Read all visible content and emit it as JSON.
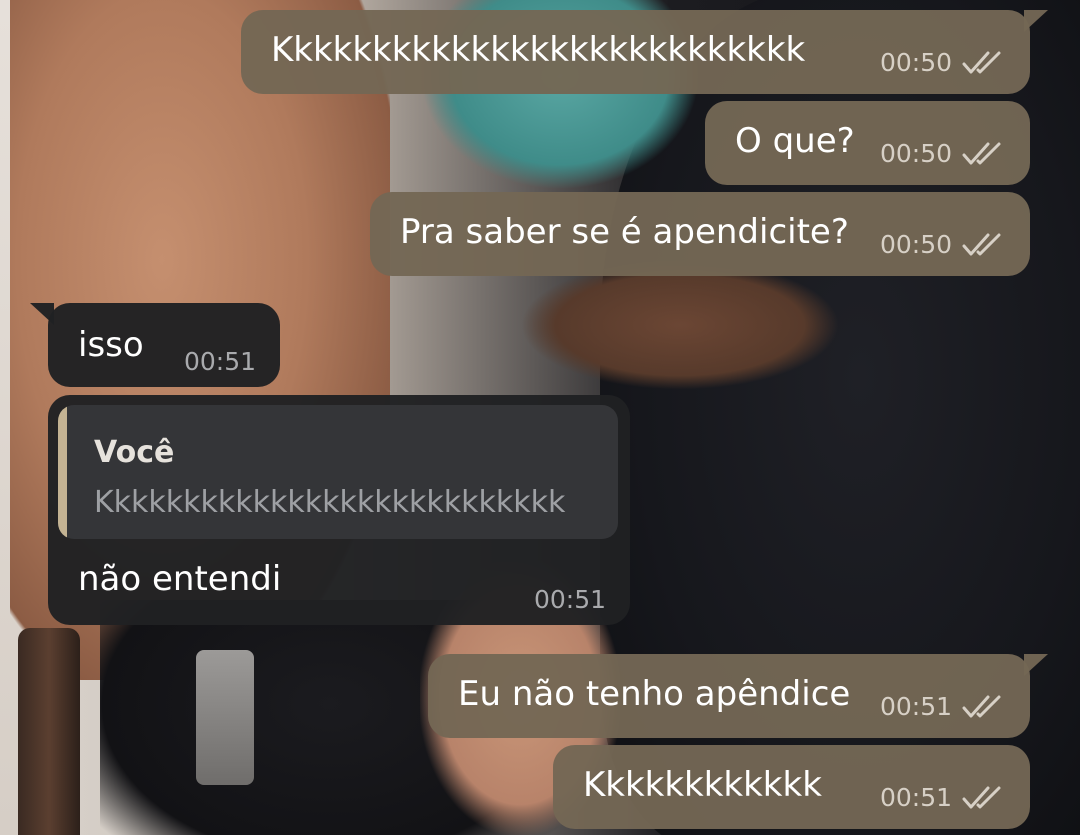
{
  "colors": {
    "outgoing_bubble": "#746754",
    "incoming_bubble": "#202123",
    "quote_accent": "#c4b393",
    "read_ticks": "#d7d0c6"
  },
  "wallpaper": {
    "type": "photo",
    "description_icon": "photo-wallpaper"
  },
  "messages": [
    {
      "direction": "out",
      "text": "Kkkkkkkkkkkkkkkkkkkkkkkkkkk",
      "time": "00:50",
      "status_icon": "double-check-icon"
    },
    {
      "direction": "out",
      "text": "O que?",
      "time": "00:50",
      "status_icon": "double-check-icon"
    },
    {
      "direction": "out",
      "text": "Pra saber se é apendicite?",
      "time": "00:50",
      "status_icon": "double-check-icon"
    },
    {
      "direction": "in",
      "text": "isso",
      "time": "00:51"
    },
    {
      "direction": "in",
      "text": "não entendi",
      "time": "00:51",
      "reply": {
        "author": "Você",
        "text": "Kkkkkkkkkkkkkkkkkkkkkkkkkkk"
      }
    },
    {
      "direction": "out",
      "text": "Eu não tenho apêndice",
      "time": "00:51",
      "status_icon": "double-check-icon"
    },
    {
      "direction": "out",
      "text": "Kkkkkkkkkkkk",
      "time": "00:51",
      "status_icon": "double-check-icon"
    }
  ]
}
